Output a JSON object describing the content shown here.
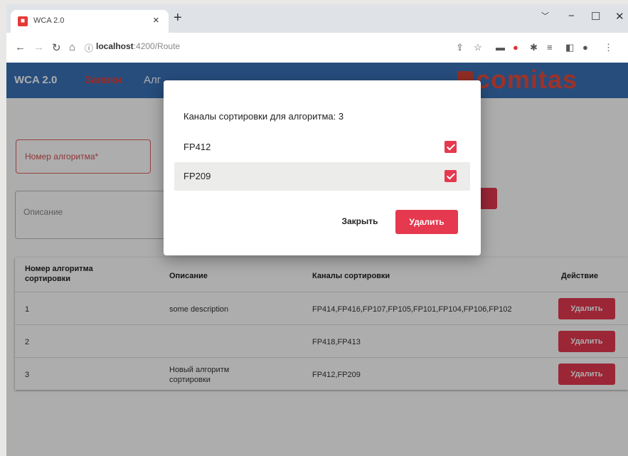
{
  "browser": {
    "tab_title": "WCA 2.0",
    "tab_close": "×",
    "new_tab": "+",
    "url_host": "localhost",
    "url_path": ":4200/Route",
    "nav_icons": [
      "back-icon",
      "forward-icon",
      "reload-icon",
      "home-icon",
      "info-icon"
    ],
    "window_buttons": [
      "﹀",
      "−",
      "☐",
      "✕"
    ]
  },
  "app": {
    "brand": "WCA 2.0",
    "nav_item_1": "Заявки",
    "nav_item_2": "Алг",
    "logo": "comitas"
  },
  "form": {
    "number_placeholder": "Номер алгоритма*",
    "description_placeholder": "Описание"
  },
  "table": {
    "headers": {
      "number": "Номер алгоритма сортировки",
      "description": "Описание",
      "channels": "Каналы сортировки",
      "action": "Действие"
    },
    "rows": [
      {
        "number": "1",
        "description": "some description",
        "channels": "FP414,FP416,FP107,FP105,FP101,FP104,FP106,FP102",
        "action": "Удалить"
      },
      {
        "number": "2",
        "description": "",
        "channels": "FP418,FP413",
        "action": "Удалить"
      },
      {
        "number": "3",
        "description": "Новый алгоритм сортировки",
        "channels": "FP412,FP209",
        "action": "Удалить"
      }
    ]
  },
  "dialog": {
    "title": "Каналы сортировки для алгоритма: 3",
    "items": [
      {
        "label": "FP412",
        "checked": true
      },
      {
        "label": "FP209",
        "checked": true
      }
    ],
    "close_label": "Закрыть",
    "delete_label": "Удалить"
  },
  "colors": {
    "app_bar": "#3a72b8",
    "accent_red": "#e53950",
    "logo_red": "#e74b3c"
  }
}
